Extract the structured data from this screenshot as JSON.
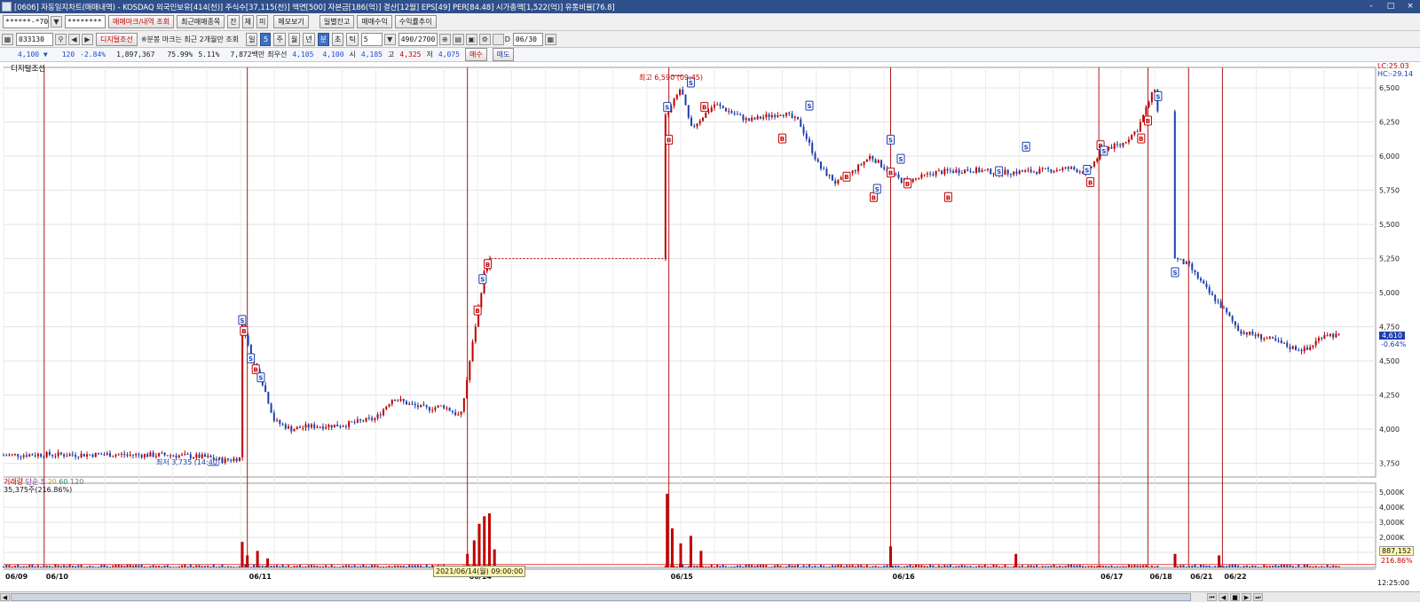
{
  "window": {
    "title": "[0606] 자동일지차트(매매내역) - KOSDAQ 외국인보유[414(천)] 주식수[37,115(천)] 액면[500] 자본금[186(억)] 결산[12월] EPS[49] PER[84.48] 시가총액[1,522(억)] 유통비율[76.8]",
    "buttons": [
      "-",
      "□",
      "×"
    ]
  },
  "toolbar1": {
    "account": "******-*70",
    "password": "********",
    "buttons": [
      "매매마크/내역 조회",
      "최근매매종목",
      "잔",
      "체",
      "미",
      "메모보기",
      "일별잔고",
      "매매수익",
      "수익률추이"
    ]
  },
  "toolbar2": {
    "stock_code": "033130",
    "indicator_button": "디지털조선",
    "notice": "※분봉 마크는 최근 2개월만 조회",
    "periods": [
      "일",
      "5",
      "주",
      "월",
      "년",
      "분",
      "초",
      "틱"
    ],
    "selected_period": "분",
    "interval": "5",
    "count": "490/2700",
    "checkbox_label": "D",
    "date": "06/30"
  },
  "quote": {
    "price": "4,100 ▼",
    "change": "120",
    "change_pct": "-2.84%",
    "volume": "1,897,367",
    "vol_ratio": "75.99%",
    "turnover": "5.11%",
    "amount": "7,872백만",
    "bid_label": "최우선",
    "bid1": "4,105",
    "bid2": "4,100",
    "open_label": "시",
    "open": "4,185",
    "high_label": "고",
    "high": "4,325",
    "low_label": "저",
    "low": "4,075",
    "buy_button": "매수",
    "sell_button": "매도"
  },
  "chart_labels": {
    "stock_name": "디지털조선",
    "lc": "LC:25.03",
    "hc": "HC:-29.14",
    "current_price": "4,610",
    "current_change": "-0.64%",
    "max_label": "최고 6,590 (09:45)",
    "min_label": "최저 3,735 (14:40)",
    "volume_legend": [
      "거래량",
      "단순",
      "5",
      "20",
      "60",
      "120"
    ],
    "volume_value": "35,375주(216.86%)",
    "volume_current": "887,152",
    "volume_current_pct": "216.86%",
    "tooltip_date": "2021/06/14(월) 09:00:00",
    "time_readout": "12:25:00"
  },
  "colors": {
    "up": "#c00000",
    "down": "#1c3fae",
    "sell_mark": "#1c3fae",
    "buy_mark": "#c00000",
    "titlebar": "#2f4f8a"
  },
  "chart_data": {
    "type": "candlestick",
    "yaxis_ticks": [
      "6,500",
      "6,250",
      "6,000",
      "5,750",
      "5,500",
      "5,250",
      "5,000",
      "4,750",
      "4,500",
      "4,250",
      "4,000",
      "3,750"
    ],
    "ylim": [
      3650,
      6650
    ],
    "volume_ticks": [
      "5,000K",
      "4,000K",
      "3,000K",
      "2,000K",
      "1,000K"
    ],
    "volume_ylim": [
      0,
      5600
    ],
    "day_labels": [
      "06/09",
      "06/10",
      "06/11",
      "06/14",
      "06/15",
      "06/16",
      "06/17",
      "06/18",
      "06/21",
      "06/22"
    ],
    "price_path": [
      [
        0,
        3810
      ],
      [
        0.5,
        3812
      ],
      [
        1,
        3815
      ],
      [
        2,
        3813
      ],
      [
        3,
        3815
      ],
      [
        4,
        3812
      ],
      [
        5,
        3810
      ],
      [
        6,
        3795
      ],
      [
        6.5,
        3770
      ],
      [
        7,
        3790
      ],
      [
        7.05,
        4800
      ],
      [
        7.3,
        4520
      ],
      [
        7.6,
        4380
      ],
      [
        8,
        4060
      ],
      [
        8.5,
        4000
      ],
      [
        9,
        4020
      ],
      [
        10,
        4030
      ],
      [
        11,
        4080
      ],
      [
        11.5,
        4230
      ],
      [
        12,
        4180
      ],
      [
        12.5,
        4150
      ],
      [
        13,
        4170
      ],
      [
        13.5,
        4090
      ],
      [
        13.6,
        4230
      ],
      [
        13.9,
        4700
      ],
      [
        14.2,
        5150
      ],
      [
        14.4,
        5260
      ],
      [
        19.6,
        6300
      ],
      [
        20,
        6500
      ],
      [
        20.3,
        6200
      ],
      [
        21,
        6380
      ],
      [
        22,
        6260
      ],
      [
        23,
        6320
      ],
      [
        23.5,
        6250
      ],
      [
        24.1,
        5920
      ],
      [
        24.6,
        5800
      ],
      [
        25.1,
        5890
      ],
      [
        25.6,
        6000
      ],
      [
        26.5,
        5820
      ],
      [
        26.9,
        5830
      ],
      [
        27.5,
        5880
      ],
      [
        28.5,
        5900
      ],
      [
        29.5,
        5880
      ],
      [
        30.5,
        5890
      ],
      [
        31.5,
        5910
      ],
      [
        32,
        5880
      ],
      [
        32.5,
        6060
      ],
      [
        33,
        6080
      ],
      [
        33.5,
        6200
      ],
      [
        34,
        6500
      ],
      [
        34.6,
        5250
      ],
      [
        35,
        5200
      ],
      [
        35.6,
        5000
      ],
      [
        35.9,
        4920
      ],
      [
        36.5,
        4720
      ],
      [
        37.5,
        4650
      ],
      [
        38,
        4600
      ],
      [
        38.5,
        4580
      ],
      [
        39,
        4700
      ],
      [
        39.5,
        4680
      ]
    ],
    "signals": [
      {
        "type": "S",
        "t": 7.05,
        "y": 4800
      },
      {
        "type": "B",
        "t": 7.1,
        "y": 4720
      },
      {
        "type": "S",
        "t": 7.3,
        "y": 4520
      },
      {
        "type": "B",
        "t": 7.45,
        "y": 4440
      },
      {
        "type": "S",
        "t": 7.6,
        "y": 4380
      },
      {
        "type": "B",
        "t": 14.0,
        "y": 4870
      },
      {
        "type": "S",
        "t": 14.15,
        "y": 5100
      },
      {
        "type": "B",
        "t": 14.3,
        "y": 5210
      },
      {
        "type": "S",
        "t": 19.6,
        "y": 6360
      },
      {
        "type": "B",
        "t": 19.65,
        "y": 6120
      },
      {
        "type": "S",
        "t": 20.3,
        "y": 6540
      },
      {
        "type": "B",
        "t": 20.7,
        "y": 6360
      },
      {
        "type": "B",
        "t": 23.0,
        "y": 6130
      },
      {
        "type": "S",
        "t": 23.8,
        "y": 6370
      },
      {
        "type": "B",
        "t": 24.9,
        "y": 5850
      },
      {
        "type": "B",
        "t": 25.7,
        "y": 5700
      },
      {
        "type": "S",
        "t": 25.8,
        "y": 5760
      },
      {
        "type": "S",
        "t": 26.2,
        "y": 6120
      },
      {
        "type": "B",
        "t": 26.2,
        "y": 5880
      },
      {
        "type": "S",
        "t": 26.5,
        "y": 5980
      },
      {
        "type": "B",
        "t": 26.7,
        "y": 5800
      },
      {
        "type": "B",
        "t": 27.9,
        "y": 5700
      },
      {
        "type": "S",
        "t": 29.4,
        "y": 5890
      },
      {
        "type": "S",
        "t": 30.2,
        "y": 6070
      },
      {
        "type": "S",
        "t": 32.0,
        "y": 5900
      },
      {
        "type": "B",
        "t": 32.1,
        "y": 5810
      },
      {
        "type": "B",
        "t": 32.4,
        "y": 6080
      },
      {
        "type": "S",
        "t": 32.5,
        "y": 6040
      },
      {
        "type": "B",
        "t": 33.6,
        "y": 6130
      },
      {
        "type": "B",
        "t": 33.8,
        "y": 6260
      },
      {
        "type": "S",
        "t": 34.1,
        "y": 6440
      },
      {
        "type": "S",
        "t": 34.6,
        "y": 5150
      }
    ],
    "volume_spikes": [
      {
        "t": 7.05,
        "v": 1700
      },
      {
        "t": 7.2,
        "v": 800
      },
      {
        "t": 7.5,
        "v": 1100
      },
      {
        "t": 7.8,
        "v": 600
      },
      {
        "t": 13.7,
        "v": 900
      },
      {
        "t": 13.9,
        "v": 1800
      },
      {
        "t": 14.05,
        "v": 2900
      },
      {
        "t": 14.2,
        "v": 3400
      },
      {
        "t": 14.35,
        "v": 3600
      },
      {
        "t": 14.5,
        "v": 1200
      },
      {
        "t": 19.6,
        "v": 4900
      },
      {
        "t": 19.75,
        "v": 2600
      },
      {
        "t": 20.0,
        "v": 1600
      },
      {
        "t": 20.3,
        "v": 2100
      },
      {
        "t": 20.6,
        "v": 1100
      },
      {
        "t": 26.2,
        "v": 1400
      },
      {
        "t": 29.9,
        "v": 900
      },
      {
        "t": 34.6,
        "v": 900
      },
      {
        "t": 35.9,
        "v": 800
      }
    ],
    "markers": [
      1.2,
      7.2,
      13.7,
      19.65,
      26.2,
      32.35,
      33.8,
      35.0,
      36.0
    ],
    "max_point": {
      "t": 20.1,
      "y": 6590
    },
    "min_point": {
      "t": 6.4,
      "y": 3735
    }
  }
}
